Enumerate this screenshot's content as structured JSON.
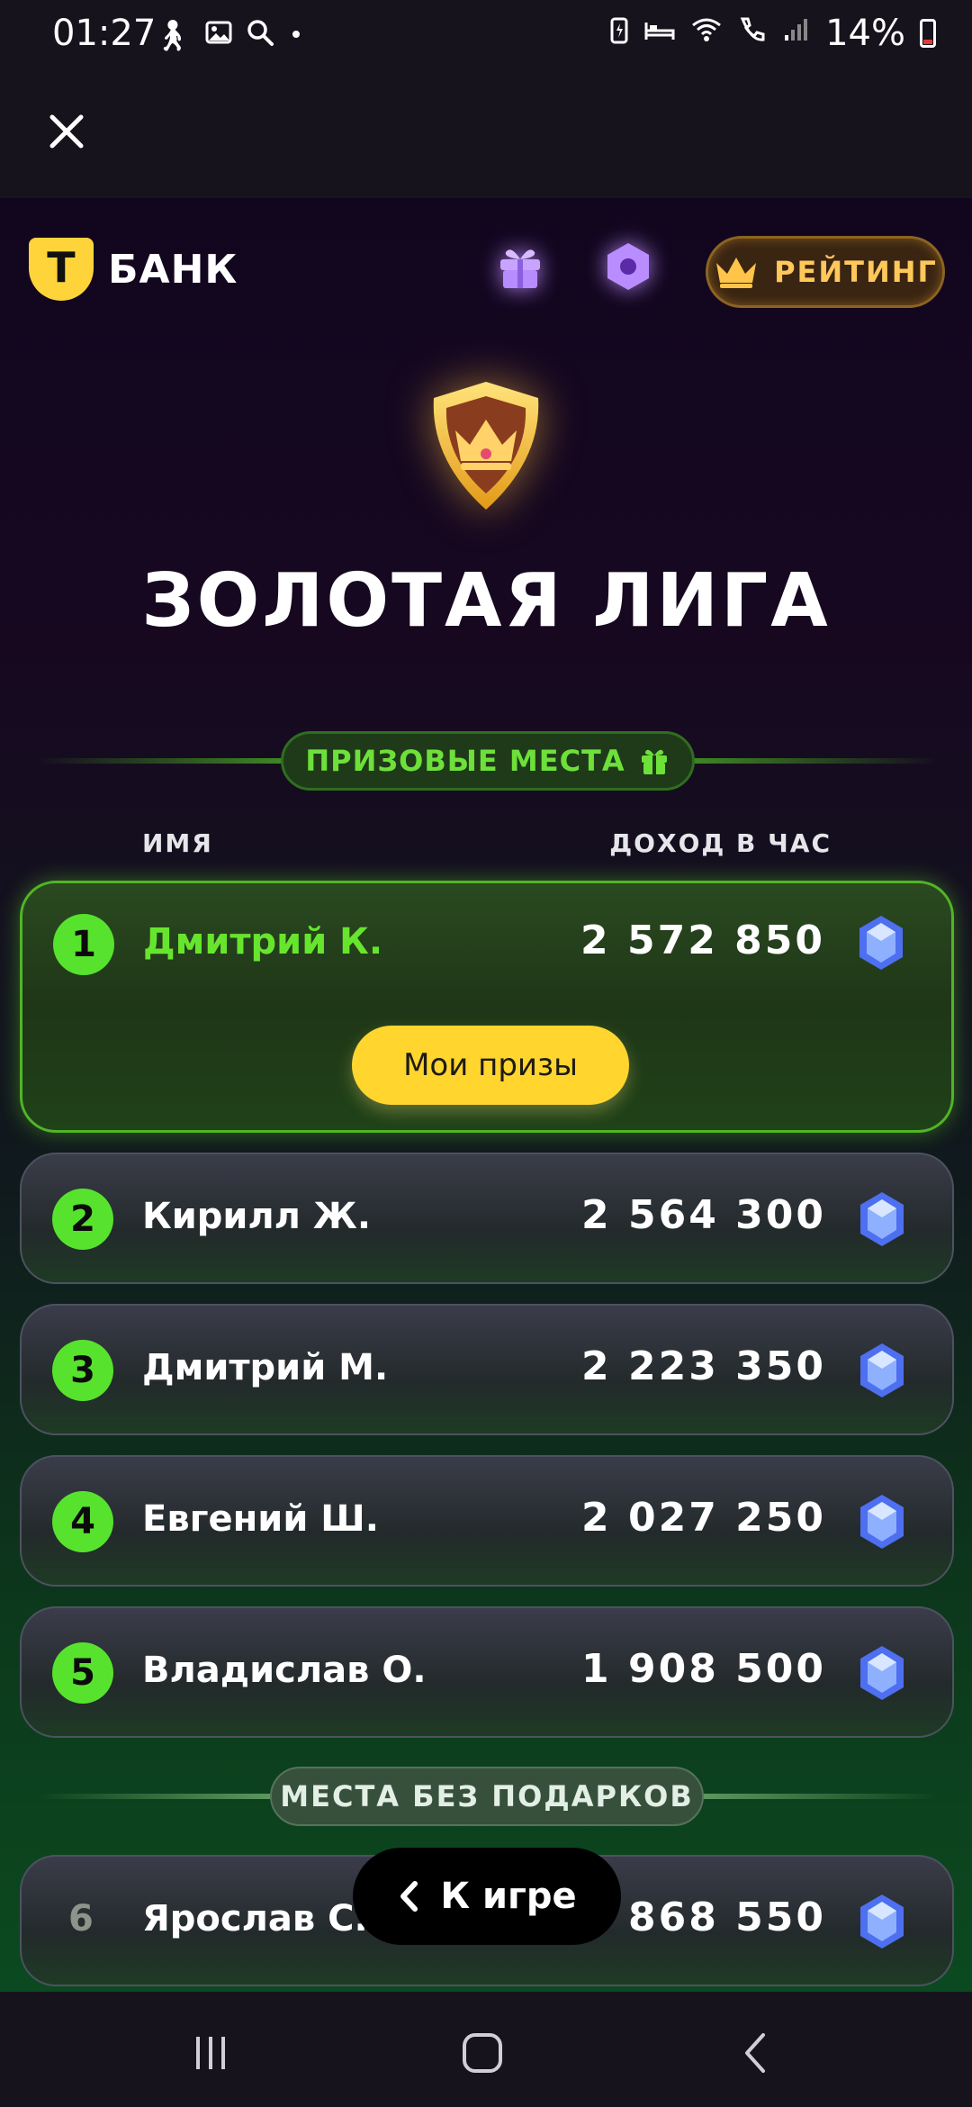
{
  "status_bar": {
    "time": "01:27",
    "battery": "14%",
    "icons": [
      "walking-icon",
      "gallery-icon",
      "search-icon",
      "dot-icon",
      "battery-saver-icon",
      "sleep-icon",
      "wifi-icon",
      "wifi-call-icon",
      "signal-icon",
      "battery-icon"
    ]
  },
  "top_bar": {
    "close_icon": "close-icon"
  },
  "header": {
    "logo_letter": "Т",
    "logo_text": "БАНК",
    "gift_icon": "gift-icon",
    "hex_icon": "hexagon-icon",
    "rating_label": "РЕЙТИНГ",
    "rating_icon": "crown-icon"
  },
  "league": {
    "title": "ЗОЛОТАЯ ЛИГА",
    "badge_icon": "crown-shield-icon"
  },
  "prize_section": {
    "label": "ПРИЗОВЫЕ МЕСТА",
    "icon": "gift-icon"
  },
  "columns": {
    "name": "ИМЯ",
    "income": "ДОХОД В ЧАС"
  },
  "leaderboard": [
    {
      "rank": "1",
      "name": "Дмитрий К.",
      "income": "2 572 850",
      "is_me": true
    },
    {
      "rank": "2",
      "name": "Кирилл Ж.",
      "income": "2 564 300"
    },
    {
      "rank": "3",
      "name": "Дмитрий М.",
      "income": "2 223 350"
    },
    {
      "rank": "4",
      "name": "Евгений Ш.",
      "income": "2 027 250"
    },
    {
      "rank": "5",
      "name": "Владислав О.",
      "income": "1 908 500"
    },
    {
      "rank": "6",
      "name": "Ярослав С.",
      "income": "1 868 550"
    }
  ],
  "my_prizes_button": "Мои призы",
  "no_prize_section": {
    "label": "МЕСТА БЕЗ ПОДАРКОВ"
  },
  "back_button": {
    "label": "К игре",
    "icon": "chevron-left-icon"
  },
  "nav_bar": {
    "recents": "recents-icon",
    "home": "home-icon",
    "back": "back-icon"
  },
  "colors": {
    "accent_green": "#57e22e",
    "gold": "#ffc85a",
    "button_yellow": "#ffd52e",
    "brand_yellow": "#ffd43b"
  }
}
